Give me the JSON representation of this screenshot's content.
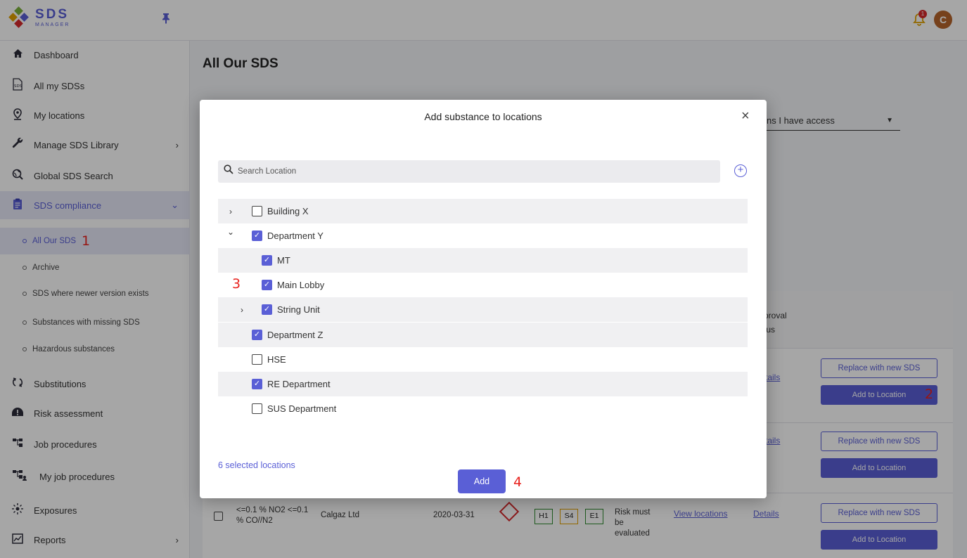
{
  "app": {
    "logo_big": "SDS",
    "logo_small": "MANAGER",
    "notification_count": "1",
    "avatar_initial": "C"
  },
  "sidebar": {
    "items": [
      {
        "label": "Dashboard",
        "icon": "home-icon"
      },
      {
        "label": "All my SDSs",
        "icon": "sds-file-icon"
      },
      {
        "label": "My locations",
        "icon": "location-pin-icon"
      },
      {
        "label": "Manage SDS Library",
        "icon": "wrench-icon",
        "chevron": "›"
      },
      {
        "label": "Global SDS Search",
        "icon": "globe-search-icon"
      },
      {
        "label": "SDS compliance",
        "icon": "clipboard-icon",
        "chevron": "⌄"
      }
    ],
    "compliance_sub": [
      {
        "label": "All Our SDS"
      },
      {
        "label": "Archive"
      },
      {
        "label": "SDS where newer version exists"
      },
      {
        "label": "Substances with missing SDS"
      },
      {
        "label": "Hazardous substances"
      }
    ],
    "items_bottom": [
      {
        "label": "Substitutions",
        "icon": "swap-icon"
      },
      {
        "label": "Risk assessment",
        "icon": "hazard-icon"
      },
      {
        "label": "Job procedures",
        "icon": "flow-icon"
      },
      {
        "label": "My job procedures",
        "icon": "flow-user-icon"
      },
      {
        "label": "Exposures",
        "icon": "exposure-icon"
      },
      {
        "label": "Reports",
        "icon": "report-icon",
        "chevron": "›"
      }
    ]
  },
  "annotations": {
    "a1": "1",
    "a2": "2",
    "a3": "3",
    "a4": "4"
  },
  "main": {
    "title": "All Our SDS",
    "filter_text": "ns I have access",
    "table_header": {
      "approval_1": "proval",
      "approval_2": "tus"
    },
    "row1": {
      "details": "tails",
      "replace": "Replace with new SDS",
      "add_to_location": "Add to Location"
    },
    "row2": {
      "details": "tails",
      "replace": "Replace with new SDS",
      "add_to_location": "Add to Location"
    },
    "row3": {
      "name_line1": "<=0.1 % NO2 <=0.1",
      "name_line2": "% CO//N2",
      "supplier": "Calgaz Ltd",
      "date": "2020-03-31",
      "h": "H1",
      "s": "S4",
      "e": "E1",
      "risk_1": "Risk must",
      "risk_2": "be",
      "risk_3": "evaluated",
      "view_locations": "View locations",
      "details": "Details",
      "replace": "Replace with new SDS",
      "add_to_location": "Add to Location"
    }
  },
  "modal": {
    "title": "Add substance to locations",
    "close": "×",
    "search_placeholder": "Search Location",
    "add_location_icon": "plus-circle-icon",
    "tree": [
      {
        "label": "Building X",
        "checked": false,
        "expander": "›"
      },
      {
        "label": "Department Y",
        "checked": true,
        "expander": "⌄"
      },
      {
        "label": "MT",
        "checked": true
      },
      {
        "label": "Main Lobby",
        "checked": true
      },
      {
        "label": "String Unit",
        "checked": true,
        "expander": "›"
      },
      {
        "label": "Department Z",
        "checked": true
      },
      {
        "label": "HSE",
        "checked": false
      },
      {
        "label": "RE Department",
        "checked": true
      },
      {
        "label": "SUS Department",
        "checked": false
      }
    ],
    "selected_count": "6 selected locations",
    "add_button": "Add"
  },
  "colors": {
    "accent": "#5a5fd6",
    "annotation": "#e8231e",
    "hazard_red": "#d6282b"
  }
}
